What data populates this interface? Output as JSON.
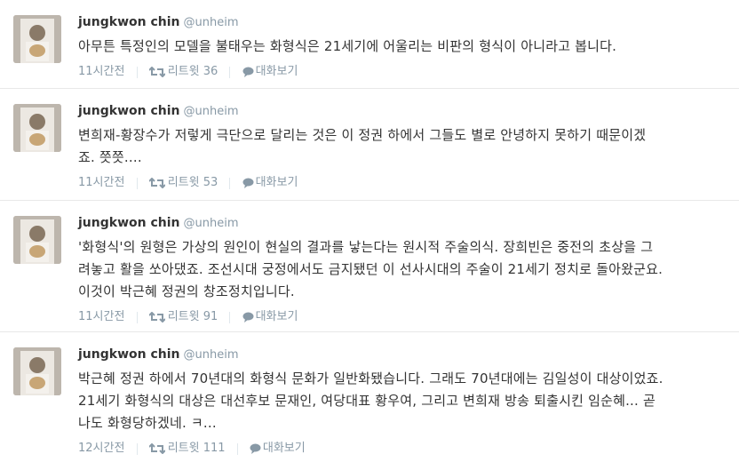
{
  "tweets": [
    {
      "author_name": "jungkwon chin",
      "author_handle": "@unheim",
      "lines": [
        "아무튼 특정인의 모델을 불태우는 화형식은 21세기에 어울리는 비판의 형식이 아니라고 봅니다."
      ],
      "time": "11시간전",
      "retweet_label": "리트윗",
      "retweet_count": "36",
      "reply_label": "대화보기"
    },
    {
      "author_name": "jungkwon chin",
      "author_handle": "@unheim",
      "lines": [
        "변희재-황장수가 저렇게 극단으로 달리는 것은 이 정권 하에서 그들도 별로 안녕하지 못하기 때문이겠",
        "죠. 쯧쯧...."
      ],
      "time": "11시간전",
      "retweet_label": "리트윗",
      "retweet_count": "53",
      "reply_label": "대화보기"
    },
    {
      "author_name": "jungkwon chin",
      "author_handle": "@unheim",
      "lines": [
        "'화형식'의 원형은 가상의 원인이 현실의 결과를 낳는다는 원시적 주술의식. 장희빈은 중전의 초상을 그",
        "려놓고 활을 쏘아댔죠. 조선시대 궁정에서도 금지됐던 이 선사시대의 주술이 21세기 정치로 돌아왔군요.",
        "이것이 박근혜 정권의 창조정치입니다."
      ],
      "time": "11시간전",
      "retweet_label": "리트윗",
      "retweet_count": "91",
      "reply_label": "대화보기"
    },
    {
      "author_name": "jungkwon chin",
      "author_handle": "@unheim",
      "lines": [
        "박근혜 정권 하에서 70년대의 화형식 문화가 일반화됐습니다. 그래도 70년대에는 김일성이 대상이었죠.",
        "21세기 화형식의 대상은 대선후보 문재인, 여당대표 황우여, 그리고 변희재 방송 퇴출시킨 임순혜... 곧",
        "나도 화형당하겠네. ㅋ..."
      ],
      "time": "12시간전",
      "retweet_label": "리트윗",
      "retweet_count": "111",
      "reply_label": "대화보기"
    }
  ],
  "colors": {
    "meta": "#8899a6",
    "text": "#333333",
    "divider": "#e8e8e8"
  }
}
